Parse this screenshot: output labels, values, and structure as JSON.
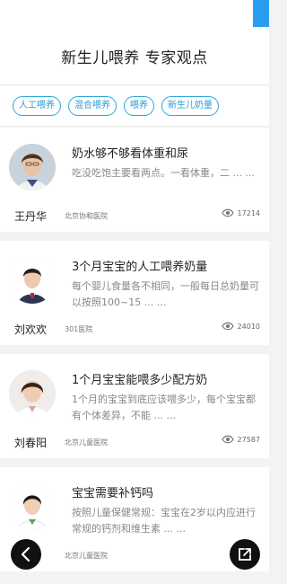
{
  "header": {
    "title": "新生儿喂养 专家观点"
  },
  "tags": [
    {
      "label": "人工喂养"
    },
    {
      "label": "混合喂养"
    },
    {
      "label": "喂养"
    },
    {
      "label": "新生儿奶量"
    }
  ],
  "articles": [
    {
      "title": "奶水够不够看体重和尿",
      "summary": "吃没吃饱主要看两点。一看体重，二 ... ...",
      "doctor": "王丹华",
      "hospital": "北京协和医院",
      "views": "17214"
    },
    {
      "title": "3个月宝宝的人工喂养奶量",
      "summary": "每个婴儿食量各不相同，一般每日总奶量可以按照100~15 ... ...",
      "doctor": "刘欢欢",
      "hospital": "301医院",
      "views": "24010"
    },
    {
      "title": "1个月宝宝能喂多少配方奶",
      "summary": "1个月的宝宝到底应该喂多少，每个宝宝都有个体差异，不能 ... ...",
      "doctor": "刘春阳",
      "hospital": "北京儿童医院",
      "views": "27587"
    },
    {
      "title": "宝宝需要补钙吗",
      "summary": "按照儿童保健常规：宝宝在2岁以内应进行常规的钙剂和维生素 ... ...",
      "doctor": "",
      "hospital": "北京儿童医院",
      "views": ""
    }
  ],
  "icons": {
    "back": "chevron-left-icon",
    "share": "share-icon",
    "views": "eye-icon"
  },
  "colors": {
    "accent": "#2a9bd4",
    "fab": "#111111"
  }
}
